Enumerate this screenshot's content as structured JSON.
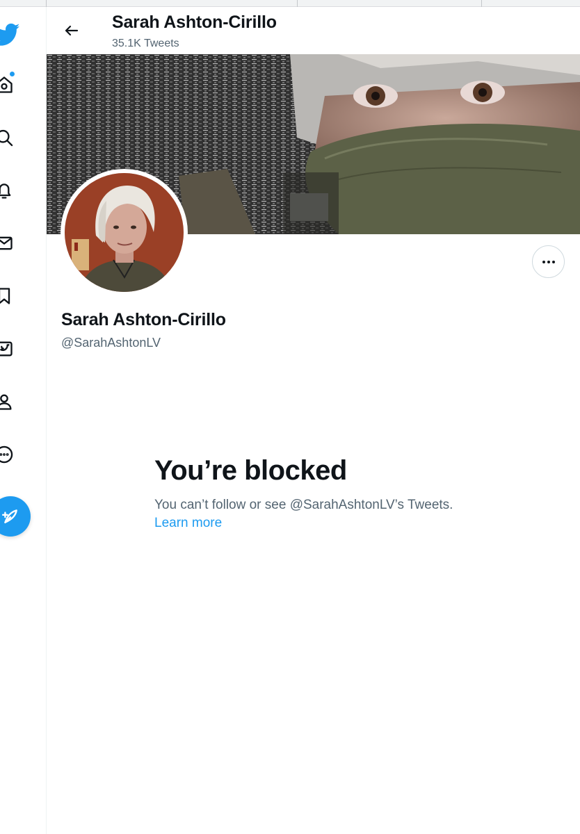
{
  "header": {
    "name": "Sarah Ashton-Cirillo",
    "tweet_count": "35.1K Tweets"
  },
  "nav": {
    "items": [
      {
        "icon": "twitter-logo-icon"
      },
      {
        "icon": "home-icon",
        "has_notification": true
      },
      {
        "icon": "search-icon"
      },
      {
        "icon": "bell-icon"
      },
      {
        "icon": "mail-icon"
      },
      {
        "icon": "bookmark-icon"
      },
      {
        "icon": "twitter-blue-icon"
      },
      {
        "icon": "profile-icon"
      },
      {
        "icon": "more-circle-icon"
      },
      {
        "icon": "compose-icon"
      }
    ]
  },
  "profile": {
    "name": "Sarah Ashton-Cirillo",
    "handle": "@SarahAshtonLV"
  },
  "blocked": {
    "title": "You’re blocked",
    "message": "You can’t follow or see @SarahAshtonLV’s Tweets.",
    "link": "Learn more"
  },
  "colors": {
    "accent": "#1d9bf0",
    "text": "#0f1419",
    "secondary_text": "#536471"
  }
}
